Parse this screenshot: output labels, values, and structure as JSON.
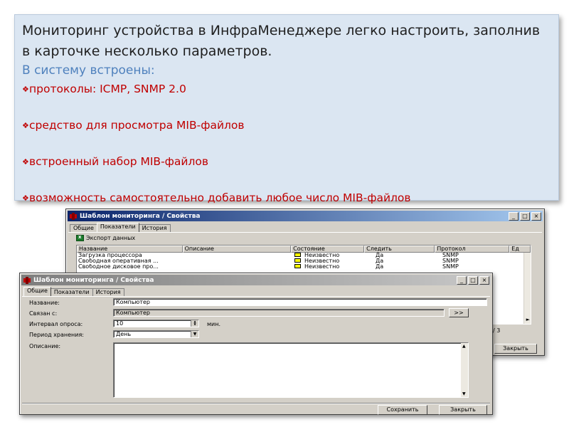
{
  "slide": {
    "intro": "Мониторинг устройства в ИнфраМенеджере легко настроить, заполнив в карточке несколько параметров.",
    "builtin_heading": "В систему встроены:",
    "bullets": [
      "протоколы: ICMP, SNMP 2.0",
      "средство для просмотра MIB-файлов",
      "встроенный набор MIB-файлов",
      "возможность самостоятельно добавить любое число MIB-файлов"
    ],
    "bullet_symbol": "❖"
  },
  "back_window": {
    "title": "Шаблон мониторинга / Свойства",
    "controls": [
      "_",
      "□",
      "×"
    ],
    "tabs": [
      "Общие",
      "Показатели",
      "История"
    ],
    "active_tab": "Показатели",
    "export_label": "Экспорт данных",
    "columns": [
      "Название",
      "Описание",
      "Состояние",
      "Следить",
      "Протокол",
      "Ед"
    ],
    "rows": [
      {
        "name": "Загрузка процессора",
        "description": "",
        "state": "Неизвестно",
        "watch": "Да",
        "protocol": "SNMP"
      },
      {
        "name": "Свободная оперативная ...",
        "description": "",
        "state": "Неизвестно",
        "watch": "Да",
        "protocol": "SNMP"
      },
      {
        "name": "Свободное дисковое про...",
        "description": "",
        "state": "Неизвестно",
        "watch": "Да",
        "protocol": "SNMP"
      }
    ],
    "page_indicator": "/ 3",
    "close_label": "Закрыть"
  },
  "front_window": {
    "title": "Шаблон мониторинга / Свойства",
    "controls": [
      "_",
      "□",
      "×"
    ],
    "tabs": [
      "Общие",
      "Показатели",
      "История"
    ],
    "active_tab": "Общие",
    "fields": {
      "name_label": "Название:",
      "name_value": "Компьютер",
      "linked_label": "Связан с:",
      "linked_value": "Компьютер",
      "linked_button": ">>",
      "interval_label": "Интервал опроса:",
      "interval_value": "10",
      "interval_unit": "мин.",
      "retention_label": "Период хранения:",
      "retention_value": "День",
      "description_label": "Описание:",
      "description_value": ""
    },
    "save_label": "Сохранить",
    "close_label": "Закрыть"
  },
  "colors": {
    "slide_box": "#dbe6f2",
    "bullet_red": "#c00000",
    "heading_blue": "#4f81bd",
    "titlebar_active": "#0a246a",
    "window_face": "#d4d0c8"
  }
}
